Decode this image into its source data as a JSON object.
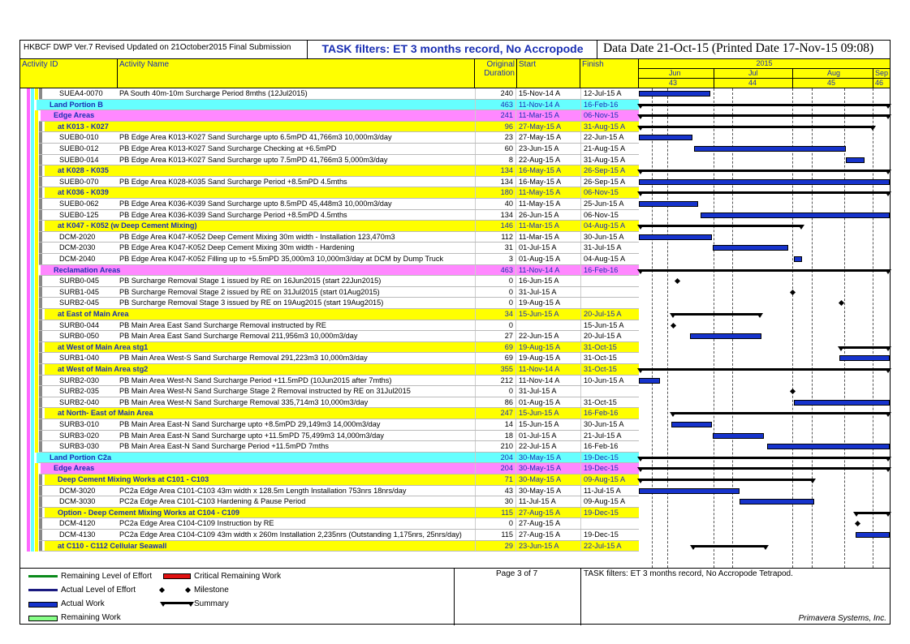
{
  "header": {
    "left": "HKBCF DWP Ver.7 Revised Updated on 21October2015 Final Submission",
    "mid": "TASK filters: ET 3 months record, No Accropode",
    "right": "Data Date 21-Oct-15 (Printed Date 17-Nov-15 09:08)"
  },
  "columns": {
    "id": "Activity ID",
    "name": "Activity Name",
    "dur1": "Original",
    "dur2": "Duration",
    "start": "Start",
    "finish": "Finish"
  },
  "timescale": {
    "year": "2015",
    "months": [
      "Jun",
      "Jul",
      "Aug",
      "Sep"
    ],
    "weeks": [
      "43",
      "44",
      "45",
      "46"
    ]
  },
  "colors": {
    "yellow": "#ffff00",
    "cyan": "#66ffff",
    "magenta": "#ff88ff",
    "bar": "#1633cc"
  },
  "rows": [
    {
      "id": "SUEA4-0070",
      "name": "PA South 40m-10m Surcharge Period 8mths (12Jul2015)",
      "dur": "240",
      "start": "15-Nov-14 A",
      "finish": "12-Jul-15 A",
      "type": "task",
      "indent": 4,
      "bar": [
        0,
        0.286
      ]
    },
    {
      "id": "",
      "name": "Land Portion B",
      "dur": "463",
      "start": "11-Nov-14 A",
      "finish": "16-Feb-16",
      "type": "wbs1",
      "sum": [
        0,
        1
      ]
    },
    {
      "id": "",
      "name": "Edge Areas",
      "dur": "241",
      "start": "11-Mar-15 A",
      "finish": "06-Nov-15",
      "type": "wbs2",
      "sum": [
        0,
        1
      ]
    },
    {
      "id": "",
      "name": "at K013 - K027",
      "dur": "96",
      "start": "27-May-15 A",
      "finish": "31-Aug-15 A",
      "type": "wbs3",
      "sum": [
        0,
        0.94
      ]
    },
    {
      "id": "SUEB0-010",
      "name": "PB Edge Area K013-K027 Sand Surcharge upto 6.5mPD 41,766m3 10,000m3/day",
      "dur": "23",
      "start": "27-May-15 A",
      "finish": "22-Jun-15 A",
      "type": "task",
      "bar": [
        0,
        0.212
      ]
    },
    {
      "id": "SUEB0-012",
      "name": "PB Edge Area K013-K027 Sand Surcharge Checking at +6.5mPD",
      "dur": "60",
      "start": "23-Jun-15 A",
      "finish": "21-Aug-15 A",
      "type": "task",
      "bar": [
        0.22,
        0.825
      ]
    },
    {
      "id": "SUEB0-014",
      "name": "PB Edge Area K013-K027 Sand Surcharge upto 7.5mPD 41,766m3 5,000m3/day",
      "dur": "8",
      "start": "22-Aug-15 A",
      "finish": "31-Aug-15 A",
      "type": "task",
      "bar": [
        0.825,
        0.9
      ]
    },
    {
      "id": "",
      "name": "at K028 - K035",
      "dur": "134",
      "start": "16-May-15 A",
      "finish": "26-Sep-15 A",
      "type": "wbs3",
      "sum": [
        0,
        1
      ]
    },
    {
      "id": "SUEB0-070",
      "name": "PB Edge Area K028-K035 Sand Surcharge Period +8.5mPD 4.5mths",
      "dur": "134",
      "start": "16-May-15 A",
      "finish": "26-Sep-15 A",
      "type": "task",
      "bar": [
        0,
        1
      ]
    },
    {
      "id": "",
      "name": "at K036 - K039",
      "dur": "180",
      "start": "11-May-15 A",
      "finish": "06-Nov-15",
      "type": "wbs3",
      "sum": [
        0,
        1
      ]
    },
    {
      "id": "SUEB0-062",
      "name": "PB Edge Area K036-K039 Sand Surcharge upto 8.5mPD 45,448m3 10,000m3/day",
      "dur": "40",
      "start": "11-May-15 A",
      "finish": "25-Jun-15 A",
      "type": "task",
      "bar": [
        0,
        0.235
      ]
    },
    {
      "id": "SUEB0-125",
      "name": "PB Edge Area K036-K039 Sand Surcharge Period +8.5mPD 4.5mths",
      "dur": "134",
      "start": "26-Jun-15 A",
      "finish": "06-Nov-15",
      "type": "task",
      "bar": [
        0.245,
        1
      ]
    },
    {
      "id": "",
      "name": "at K047 - K052 (w Deep Cement Mixing)",
      "dur": "146",
      "start": "11-Mar-15 A",
      "finish": "04-Aug-15 A",
      "type": "wbs3",
      "sum": [
        0,
        0.655
      ]
    },
    {
      "id": "DCM-2020",
      "name": "PB Edge Area K047-K052 Deep Cement Mixing 30m width - Installation 123,470m3",
      "dur": "112",
      "start": "11-Mar-15 A",
      "finish": "30-Jun-15 A",
      "type": "task",
      "bar": [
        0,
        0.29
      ]
    },
    {
      "id": "DCM-2030",
      "name": "PB Edge Area K047-K052 Deep Cement Mixing 30m width - Hardening",
      "dur": "31",
      "start": "01-Jul-15 A",
      "finish": "31-Jul-15 A",
      "type": "task",
      "bar": [
        0.295,
        0.595
      ]
    },
    {
      "id": "DCM-2040",
      "name": "PB Edge Area K047-K052 Filling up to +5.5mPD 35,000m3 10,000m3/day at DCM by Dump Truck",
      "dur": "3",
      "start": "01-Aug-15 A",
      "finish": "04-Aug-15 A",
      "type": "task",
      "bar": [
        0.617,
        0.65
      ]
    },
    {
      "id": "",
      "name": "Reclamation Areas",
      "dur": "463",
      "start": "11-Nov-14 A",
      "finish": "16-Feb-16",
      "type": "wbs2",
      "sum": [
        0,
        1
      ]
    },
    {
      "id": "SURB0-045",
      "name": "PB Surcharge Removal Stage 1 issued by RE on 16Jun2015 (start 22Jun2015)",
      "dur": "0",
      "start": "16-Jun-15 A",
      "finish": "",
      "type": "task",
      "ms": 0.146
    },
    {
      "id": "SURB1-045",
      "name": "PB Surcharge Removal Stage 2 issued by RE on 31Jul2015 (start 01Aug2015)",
      "dur": "0",
      "start": "31-Jul-15 A",
      "finish": "",
      "type": "task",
      "ms": 0.605
    },
    {
      "id": "SURB2-045",
      "name": "PB Surcharge Removal Stage 3 issued by RE on 19Aug2015 (start 19Aug2015)",
      "dur": "0",
      "start": "19-Aug-15 A",
      "finish": "",
      "type": "task",
      "ms": 0.8
    },
    {
      "id": "",
      "name": "at East of Main Area",
      "dur": "34",
      "start": "15-Jun-15 A",
      "finish": "20-Jul-15 A",
      "type": "wbs3",
      "sum": [
        0.128,
        0.49
      ]
    },
    {
      "id": "SURB0-044",
      "name": "PB Main Area East Sand Surcharge Removal instructed by RE",
      "dur": "0",
      "start": "",
      "finish": "15-Jun-15 A",
      "type": "task",
      "ms": 0.128
    },
    {
      "id": "SURB0-050",
      "name": "PB Main Area East Sand Surcharge Removal 211,956m3 10,000m3/day",
      "dur": "27",
      "start": "22-Jun-15 A",
      "finish": "20-Jul-15 A",
      "type": "task",
      "bar": [
        0.205,
        0.49
      ]
    },
    {
      "id": "",
      "name": "at West of Main Area stg1",
      "dur": "69",
      "start": "19-Aug-15 A",
      "finish": "31-Oct-15",
      "type": "wbs3",
      "sum": [
        0.8,
        1
      ]
    },
    {
      "id": "SURB1-040",
      "name": "PB Main Area West-S Sand Surcharge Removal 291,223m3 10,000m3/day",
      "dur": "69",
      "start": "19-Aug-15 A",
      "finish": "31-Oct-15",
      "type": "task",
      "bar": [
        0.8,
        1
      ]
    },
    {
      "id": "",
      "name": "at West of Main Area stg2",
      "dur": "355",
      "start": "11-Nov-14 A",
      "finish": "31-Oct-15",
      "type": "wbs3",
      "sum": [
        0,
        1
      ]
    },
    {
      "id": "SURB2-030",
      "name": "PB Main Area West-N Sand Surcharge Period +11.5mPD (10Jun2015 after 7mths)",
      "dur": "212",
      "start": "11-Nov-14 A",
      "finish": "10-Jun-15 A",
      "type": "task",
      "bar": [
        0,
        0.085
      ]
    },
    {
      "id": "SURB2-035",
      "name": "PB Main Area West-N Sand Surcharge Stage 2 Removal instructed by RE on 31Jul2015",
      "dur": "0",
      "start": "31-Jul-15 A",
      "finish": "",
      "type": "task",
      "ms": 0.605
    },
    {
      "id": "SURB2-040",
      "name": "PB Main Area West-N Sand Surcharge Removal 335,714m3 10,000m3/day",
      "dur": "86",
      "start": "01-Aug-15 A",
      "finish": "31-Oct-15",
      "type": "task",
      "bar": [
        0.617,
        1
      ]
    },
    {
      "id": "",
      "name": "at North- East of Main Area",
      "dur": "247",
      "start": "15-Jun-15 A",
      "finish": "16-Feb-16",
      "type": "wbs3",
      "sum": [
        0.128,
        1
      ]
    },
    {
      "id": "SURB3-010",
      "name": "PB Main Area East-N Sand Surcharge upto +8.5mPD 29,149m3 14,000m3/day",
      "dur": "14",
      "start": "15-Jun-15 A",
      "finish": "30-Jun-15 A",
      "type": "task",
      "bar": [
        0.128,
        0.29
      ]
    },
    {
      "id": "SURB3-020",
      "name": "PB Main Area East-N Sand Surcharge upto +11.5mPD 75,499m3 14,000m3/day",
      "dur": "18",
      "start": "01-Jul-15 A",
      "finish": "21-Jul-15 A",
      "type": "task",
      "bar": [
        0.295,
        0.5
      ]
    },
    {
      "id": "SURB3-030",
      "name": "PB Main Area East-N Sand Surcharge Period +11.5mPD 7mths",
      "dur": "210",
      "start": "22-Jul-15 A",
      "finish": "16-Feb-16",
      "type": "task",
      "bar": [
        0.51,
        1
      ]
    },
    {
      "id": "",
      "name": "Land Portion C2a",
      "dur": "204",
      "start": "30-May-15 A",
      "finish": "19-Dec-15",
      "type": "wbs1",
      "sum": [
        0,
        1
      ]
    },
    {
      "id": "",
      "name": "Edge Areas",
      "dur": "204",
      "start": "30-May-15 A",
      "finish": "19-Dec-15",
      "type": "wbs2",
      "sum": [
        0,
        1
      ]
    },
    {
      "id": "",
      "name": "Deep Cement Mixing Works at C101 - C103",
      "dur": "71",
      "start": "30-May-15 A",
      "finish": "09-Aug-15 A",
      "type": "wbs3",
      "sum": [
        0,
        0.7
      ]
    },
    {
      "id": "DCM-3020",
      "name": "PC2a Edge Area C101-C103 43m width x 128.5m Length Installation 753nrs 18nrs/day",
      "dur": "43",
      "start": "30-May-15 A",
      "finish": "11-Jul-15 A",
      "type": "task",
      "bar": [
        0,
        0.4
      ]
    },
    {
      "id": "DCM-3030",
      "name": "PC2a Edge Area C101-C103 Hardening & Pause Period",
      "dur": "30",
      "start": "11-Jul-15 A",
      "finish": "09-Aug-15 A",
      "type": "task",
      "bar": [
        0.4,
        0.7
      ]
    },
    {
      "id": "",
      "name": "Option - Deep Cement Mixing Works at C104 - C109",
      "dur": "115",
      "start": "27-Aug-15 A",
      "finish": "19-Dec-15",
      "type": "wbs3",
      "sum": [
        0.86,
        1
      ]
    },
    {
      "id": "DCM-4120",
      "name": "PC2a Edge Area C104-C109 Instruction by RE",
      "dur": "0",
      "start": "27-Aug-15 A",
      "finish": "",
      "type": "task",
      "ms": 0.865
    },
    {
      "id": "DCM-4130",
      "name": "PC2a Edge Area C104-C109 43m width x 260m Installation 2,235nrs (Outstanding 1,175nrs, 25nrs/day)",
      "dur": "115",
      "start": "27-Aug-15 A",
      "finish": "19-Dec-15",
      "type": "task",
      "bar": [
        0.865,
        1
      ]
    },
    {
      "id": "",
      "name": "at C110 - C112 Cellular Seawall",
      "dur": "29",
      "start": "23-Jun-15 A",
      "finish": "22-Jul-15 A",
      "type": "wbs3",
      "sum": [
        0.21,
        0.51
      ]
    }
  ],
  "legend": {
    "rem_loe": "Remaining Level of Effort",
    "act_loe": "Actual Level of Effort",
    "act_work": "Actual Work",
    "rem_work": "Remaining Work",
    "critical": "Critical Remaining Work",
    "milestone": "Milestone",
    "summary": "Summary",
    "page": "Page 3 of 7",
    "filter": "TASK filters: ET 3 months record, No Accropode Tetrapod.",
    "vendor": "Primavera Systems, Inc."
  }
}
